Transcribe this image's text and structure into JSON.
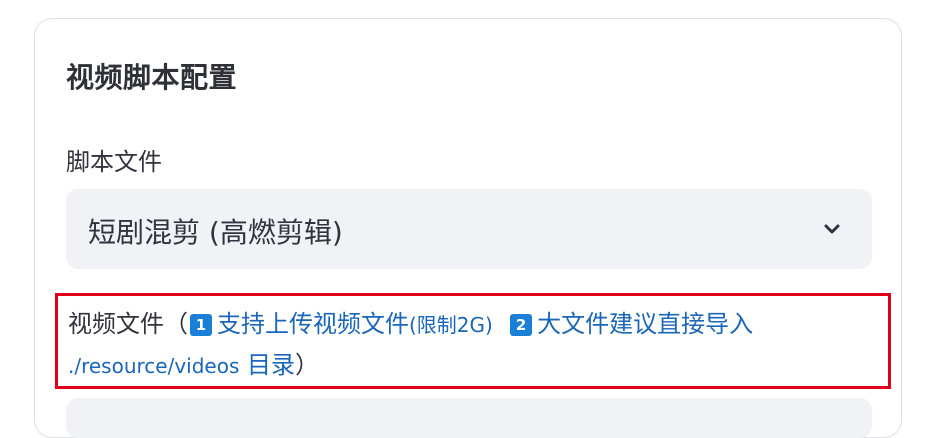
{
  "card": {
    "title": "视频脚本配置"
  },
  "script_field": {
    "label": "脚本文件",
    "selected_value": "短剧混剪 (高燃剪辑)",
    "chevron_icon": "chevron-down-icon"
  },
  "video_field": {
    "label_prefix": "视频文件（",
    "badge_1": "1",
    "note_1_text": "支持上传视频文件",
    "note_1_limit": "(限制2G)",
    "badge_2": "2",
    "note_2_text": "大文件建议直接导入",
    "note_2_path": "./resource/videos",
    "note_2_suffix": "目录",
    "label_suffix": "）"
  },
  "colors": {
    "accent_link": "#1a66b8",
    "badge_bg": "#1a7fd6",
    "highlight_border": "#e0001b",
    "input_bg": "#f0f2f6"
  }
}
